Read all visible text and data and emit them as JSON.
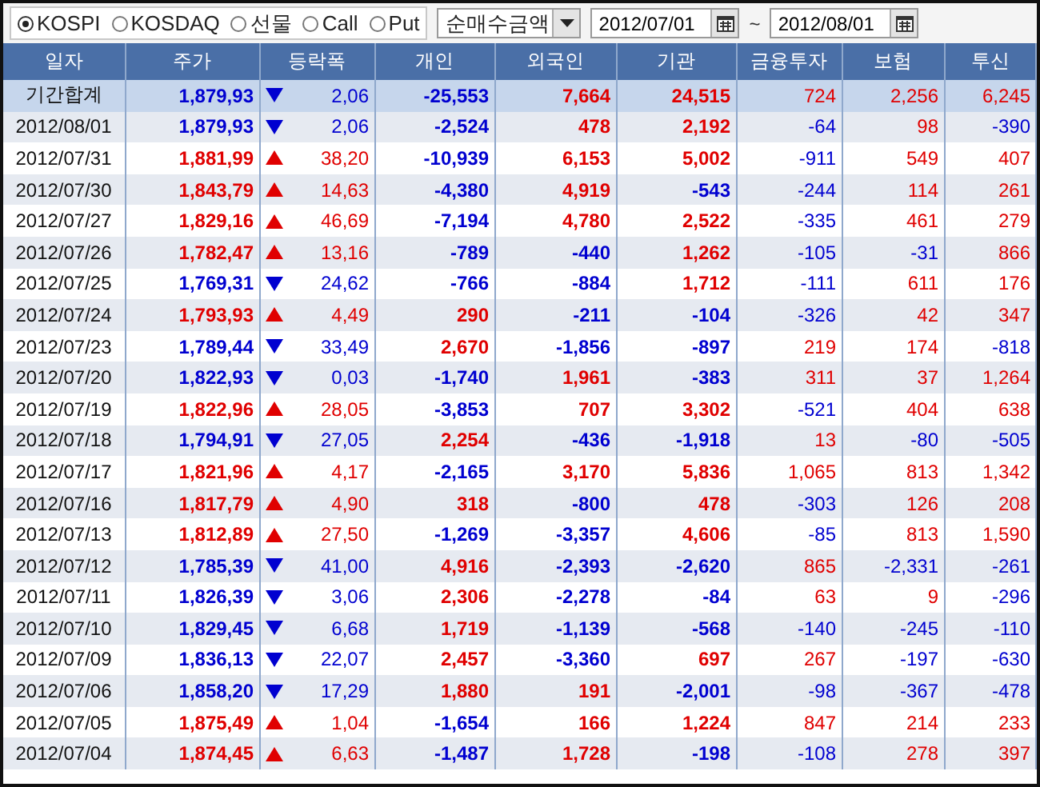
{
  "toolbar": {
    "markets": [
      {
        "label": "KOSPI",
        "selected": true
      },
      {
        "label": "KOSDAQ",
        "selected": false
      },
      {
        "label": "선물",
        "selected": false
      },
      {
        "label": "Call",
        "selected": false
      },
      {
        "label": "Put",
        "selected": false
      }
    ],
    "metric": "순매수금액",
    "date_from": "2012/07/01",
    "separator": "~",
    "date_to": "2012/08/01"
  },
  "table": {
    "columns": [
      "일자",
      "주가",
      "등락폭",
      "개인",
      "외국인",
      "기관",
      "금융투자",
      "보험",
      "투신"
    ],
    "summary": {
      "date": "기간합계",
      "price": "1,879,93",
      "kind": "down",
      "change": "2,06",
      "values": [
        "-25,553",
        "7,664",
        "24,515",
        "724",
        "2,256",
        "6,245"
      ]
    },
    "rows": [
      {
        "date": "2012/08/01",
        "price": "1,879,93",
        "kind": "down",
        "change": "2,06",
        "values": [
          "-2,524",
          "478",
          "2,192",
          "-64",
          "98",
          "-390"
        ]
      },
      {
        "date": "2012/07/31",
        "price": "1,881,99",
        "kind": "up",
        "change": "38,20",
        "values": [
          "-10,939",
          "6,153",
          "5,002",
          "-911",
          "549",
          "407"
        ]
      },
      {
        "date": "2012/07/30",
        "price": "1,843,79",
        "kind": "up",
        "change": "14,63",
        "values": [
          "-4,380",
          "4,919",
          "-543",
          "-244",
          "114",
          "261"
        ]
      },
      {
        "date": "2012/07/27",
        "price": "1,829,16",
        "kind": "up",
        "change": "46,69",
        "values": [
          "-7,194",
          "4,780",
          "2,522",
          "-335",
          "461",
          "279"
        ]
      },
      {
        "date": "2012/07/26",
        "price": "1,782,47",
        "kind": "up",
        "change": "13,16",
        "values": [
          "-789",
          "-440",
          "1,262",
          "-105",
          "-31",
          "866"
        ]
      },
      {
        "date": "2012/07/25",
        "price": "1,769,31",
        "kind": "down",
        "change": "24,62",
        "values": [
          "-766",
          "-884",
          "1,712",
          "-111",
          "611",
          "176"
        ]
      },
      {
        "date": "2012/07/24",
        "price": "1,793,93",
        "kind": "up",
        "change": "4,49",
        "values": [
          "290",
          "-211",
          "-104",
          "-326",
          "42",
          "347"
        ]
      },
      {
        "date": "2012/07/23",
        "price": "1,789,44",
        "kind": "down",
        "change": "33,49",
        "values": [
          "2,670",
          "-1,856",
          "-897",
          "219",
          "174",
          "-818"
        ]
      },
      {
        "date": "2012/07/20",
        "price": "1,822,93",
        "kind": "down",
        "change": "0,03",
        "values": [
          "-1,740",
          "1,961",
          "-383",
          "311",
          "37",
          "1,264"
        ]
      },
      {
        "date": "2012/07/19",
        "price": "1,822,96",
        "kind": "up",
        "change": "28,05",
        "values": [
          "-3,853",
          "707",
          "3,302",
          "-521",
          "404",
          "638"
        ]
      },
      {
        "date": "2012/07/18",
        "price": "1,794,91",
        "kind": "down",
        "change": "27,05",
        "values": [
          "2,254",
          "-436",
          "-1,918",
          "13",
          "-80",
          "-505"
        ]
      },
      {
        "date": "2012/07/17",
        "price": "1,821,96",
        "kind": "up",
        "change": "4,17",
        "values": [
          "-2,165",
          "3,170",
          "5,836",
          "1,065",
          "813",
          "1,342"
        ]
      },
      {
        "date": "2012/07/16",
        "price": "1,817,79",
        "kind": "up",
        "change": "4,90",
        "values": [
          "318",
          "-800",
          "478",
          "-303",
          "126",
          "208"
        ]
      },
      {
        "date": "2012/07/13",
        "price": "1,812,89",
        "kind": "up",
        "change": "27,50",
        "values": [
          "-1,269",
          "-3,357",
          "4,606",
          "-85",
          "813",
          "1,590"
        ]
      },
      {
        "date": "2012/07/12",
        "price": "1,785,39",
        "kind": "down",
        "change": "41,00",
        "values": [
          "4,916",
          "-2,393",
          "-2,620",
          "865",
          "-2,331",
          "-261"
        ]
      },
      {
        "date": "2012/07/11",
        "price": "1,826,39",
        "kind": "down",
        "change": "3,06",
        "values": [
          "2,306",
          "-2,278",
          "-84",
          "63",
          "9",
          "-296"
        ]
      },
      {
        "date": "2012/07/10",
        "price": "1,829,45",
        "kind": "down",
        "change": "6,68",
        "values": [
          "1,719",
          "-1,139",
          "-568",
          "-140",
          "-245",
          "-110"
        ]
      },
      {
        "date": "2012/07/09",
        "price": "1,836,13",
        "kind": "down",
        "change": "22,07",
        "values": [
          "2,457",
          "-3,360",
          "697",
          "267",
          "-197",
          "-630"
        ]
      },
      {
        "date": "2012/07/06",
        "price": "1,858,20",
        "kind": "down",
        "change": "17,29",
        "values": [
          "1,880",
          "191",
          "-2,001",
          "-98",
          "-367",
          "-478"
        ]
      },
      {
        "date": "2012/07/05",
        "price": "1,875,49",
        "kind": "up",
        "change": "1,04",
        "values": [
          "-1,654",
          "166",
          "1,224",
          "847",
          "214",
          "233"
        ]
      },
      {
        "date": "2012/07/04",
        "price": "1,874,45",
        "kind": "up",
        "change": "6,63",
        "values": [
          "-1,487",
          "1,728",
          "-198",
          "-108",
          "278",
          "397"
        ]
      }
    ]
  }
}
